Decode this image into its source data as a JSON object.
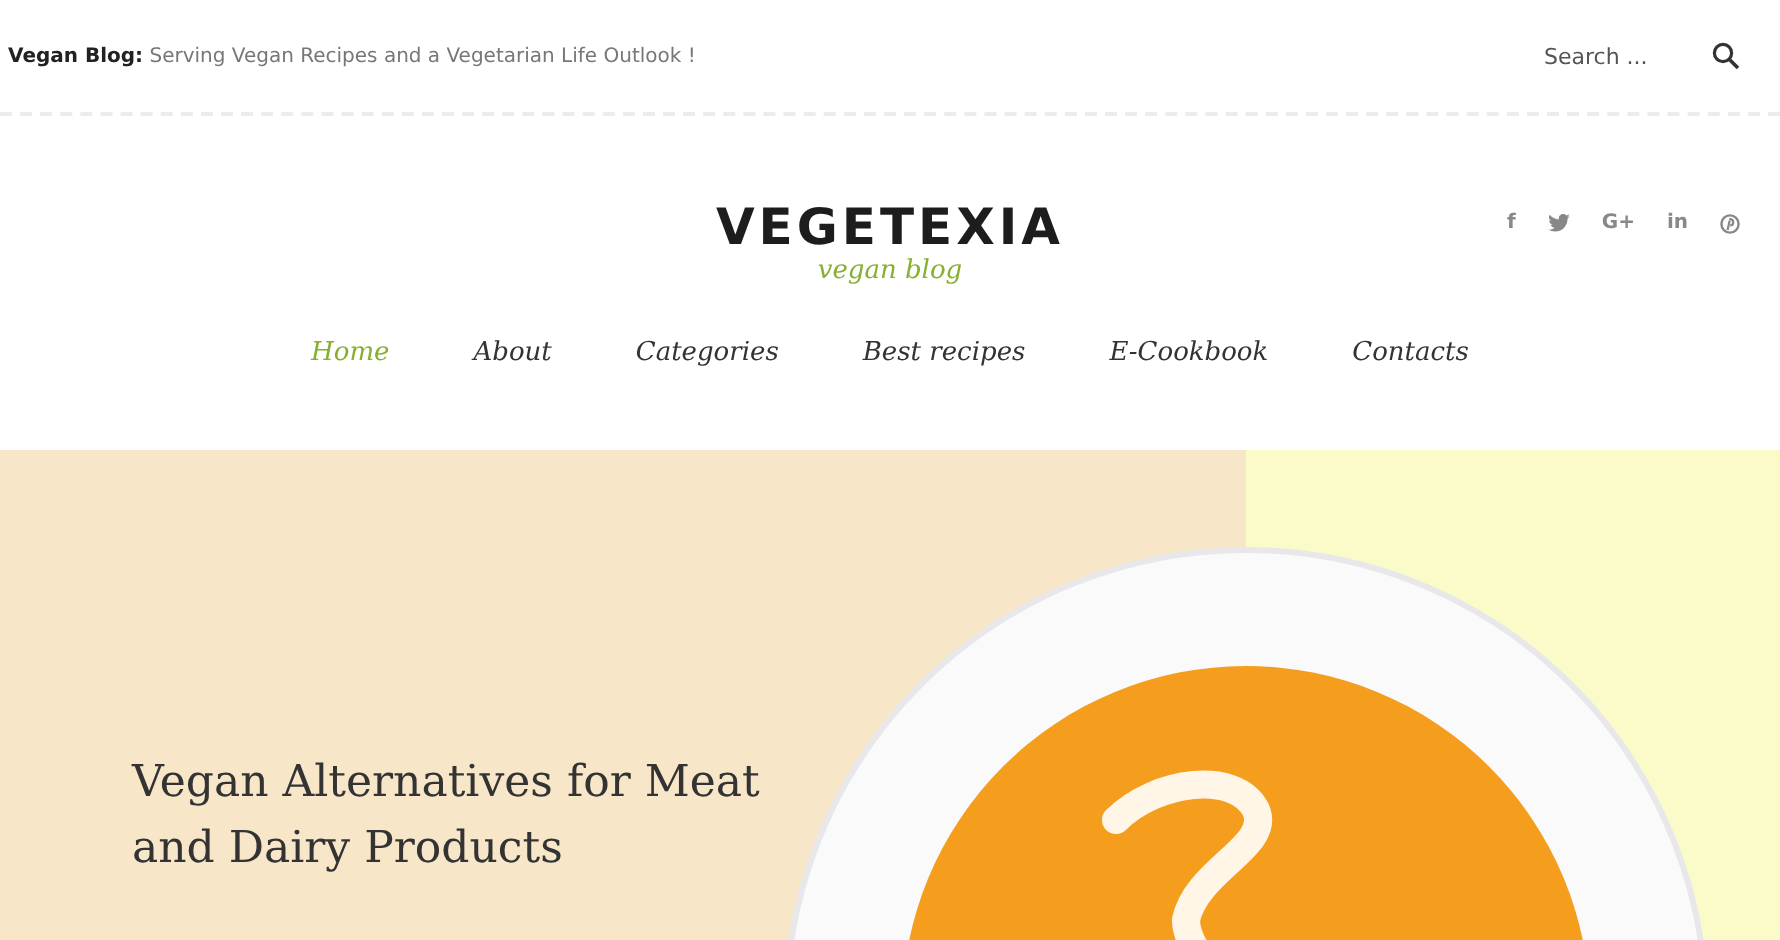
{
  "top_bar": {
    "tagline": "**Vegan Blog:** Serving Vegan Recipes and a Vegetarian Life Outlook !",
    "search": {
      "placeholder": "Search ..."
    }
  },
  "header": {
    "logo": "VEGETEXIA",
    "subtitle": "vegan blog",
    "social": [
      {
        "kind": "glyph",
        "text": "f"
      },
      {
        "kind": "bird"
      },
      {
        "kind": "glyph",
        "text": "G+"
      },
      {
        "kind": "glyph",
        "text": "in"
      },
      {
        "kind": "pin"
      }
    ]
  },
  "nav": [
    {
      "label": "Home",
      "selected": true
    },
    {
      "label": "About",
      "selected": false
    },
    {
      "label": "Categories",
      "selected": false
    },
    {
      "label": "Best recipes",
      "selected": false
    },
    {
      "label": "E-Cookbook",
      "selected": false
    },
    {
      "label": "Contacts",
      "selected": false
    }
  ],
  "hero": {
    "title": "Vegan Alternatives for Meat and Dairy Products"
  }
}
